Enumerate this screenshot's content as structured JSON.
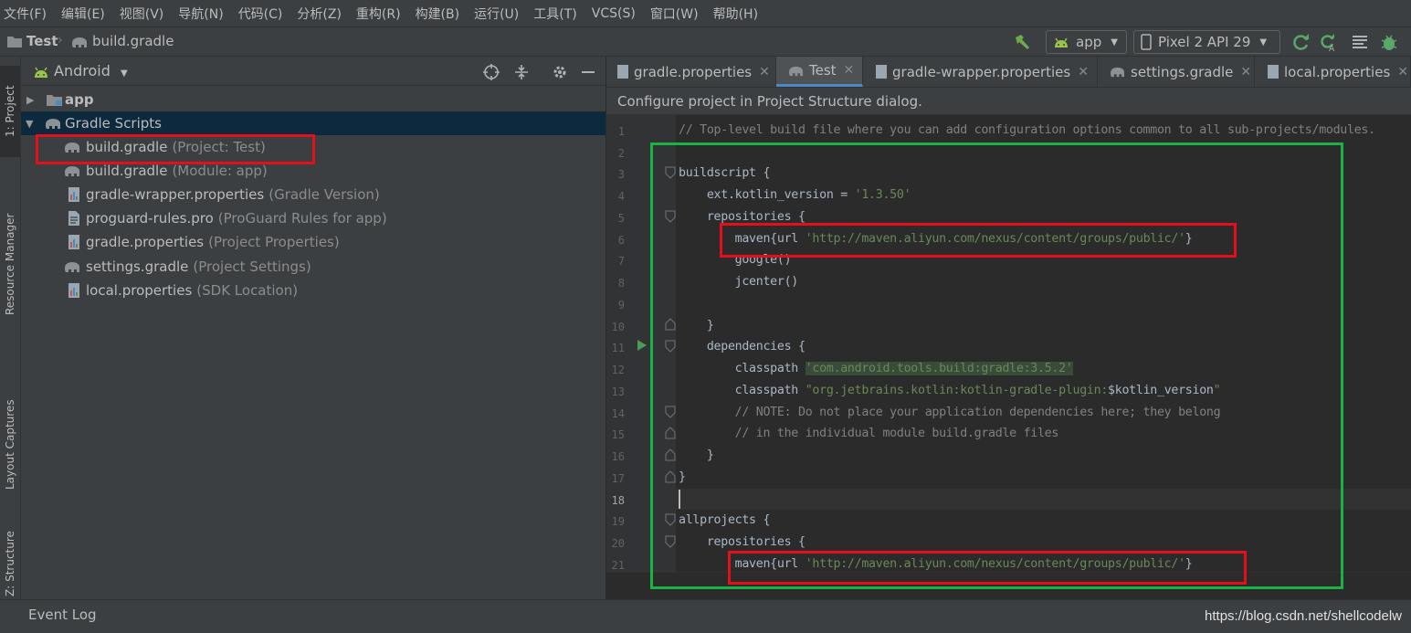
{
  "menu": [
    "文件(F)",
    "编辑(E)",
    "视图(V)",
    "导航(N)",
    "代码(C)",
    "分析(Z)",
    "重构(R)",
    "构建(B)",
    "运行(U)",
    "工具(T)",
    "VCS(S)",
    "窗口(W)",
    "帮助(H)"
  ],
  "breadcrumb": {
    "project": "Test",
    "file": "build.gradle"
  },
  "toolbar": {
    "config": "app",
    "device": "Pixel 2 API 29"
  },
  "left_tabs": {
    "project": "1: Project",
    "resource": "Resource Manager",
    "layout": "Layout Captures",
    "structure": "Z: Structure"
  },
  "panel": {
    "view_mode": "Android"
  },
  "tree": {
    "app": "app",
    "gradle_scripts": "Gradle Scripts",
    "items": [
      {
        "name": "build.gradle",
        "hint": "(Project: Test)",
        "icon": "gradle-elephant-icon"
      },
      {
        "name": "build.gradle",
        "hint": "(Module: app)",
        "icon": "gradle-elephant-icon"
      },
      {
        "name": "gradle-wrapper.properties",
        "hint": "(Gradle Version)",
        "icon": "properties-file-icon"
      },
      {
        "name": "proguard-rules.pro",
        "hint": "(ProGuard Rules for app)",
        "icon": "text-file-icon"
      },
      {
        "name": "gradle.properties",
        "hint": "(Project Properties)",
        "icon": "properties-file-icon"
      },
      {
        "name": "settings.gradle",
        "hint": "(Project Settings)",
        "icon": "gradle-elephant-icon"
      },
      {
        "name": "local.properties",
        "hint": "(SDK Location)",
        "icon": "properties-file-icon"
      }
    ]
  },
  "tabs": [
    "gradle.properties",
    "Test",
    "gradle-wrapper.properties",
    "settings.gradle",
    "local.properties"
  ],
  "banner": "Configure project in Project Structure dialog.",
  "line_numbers": [
    "1",
    "2",
    "3",
    "4",
    "5",
    "6",
    "7",
    "8",
    "9",
    "10",
    "11",
    "12",
    "13",
    "14",
    "15",
    "16",
    "17",
    "18",
    "19",
    "20",
    "21"
  ],
  "code": {
    "l1": "// Top-level build file where you can add configuration options common to all sub-projects/modules.",
    "l3": "buildscript {",
    "l4_a": "    ext.kotlin_version = ",
    "l4_b": "'1.3.50'",
    "l5": "    repositories {",
    "l6_a": "        maven{url ",
    "l6_b": "'http://maven.aliyun.com/nexus/content/groups/public/'",
    "l6_c": "}",
    "l7": "        google()",
    "l8": "        jcenter()",
    "l10": "    }",
    "l11": "    dependencies {",
    "l12_a": "        classpath ",
    "l12_b": "'com.android.tools.build:gradle:3.5.2'",
    "l13_a": "        classpath ",
    "l13_b": "\"org.jetbrains.kotlin:kotlin-gradle-plugin:",
    "l13_c": "$kotlin_version",
    "l13_d": "\"",
    "l14": "        // NOTE: Do not place your application dependencies here; they belong",
    "l15": "        // in the individual module build.gradle files",
    "l16": "    }",
    "l17": "}",
    "l19": "allprojects {",
    "l20": "    repositories {",
    "l21_a": "        maven{url ",
    "l21_b": "'http://maven.aliyun.com/nexus/content/groups/public/'",
    "l21_c": "}"
  },
  "status": {
    "event_log": "Event Log",
    "watermark": "https://blog.csdn.net/shellcodelw"
  },
  "colors": {
    "highlight_red": "#e3101c",
    "highlight_green": "#19b341",
    "accent": "#4a88c7"
  }
}
